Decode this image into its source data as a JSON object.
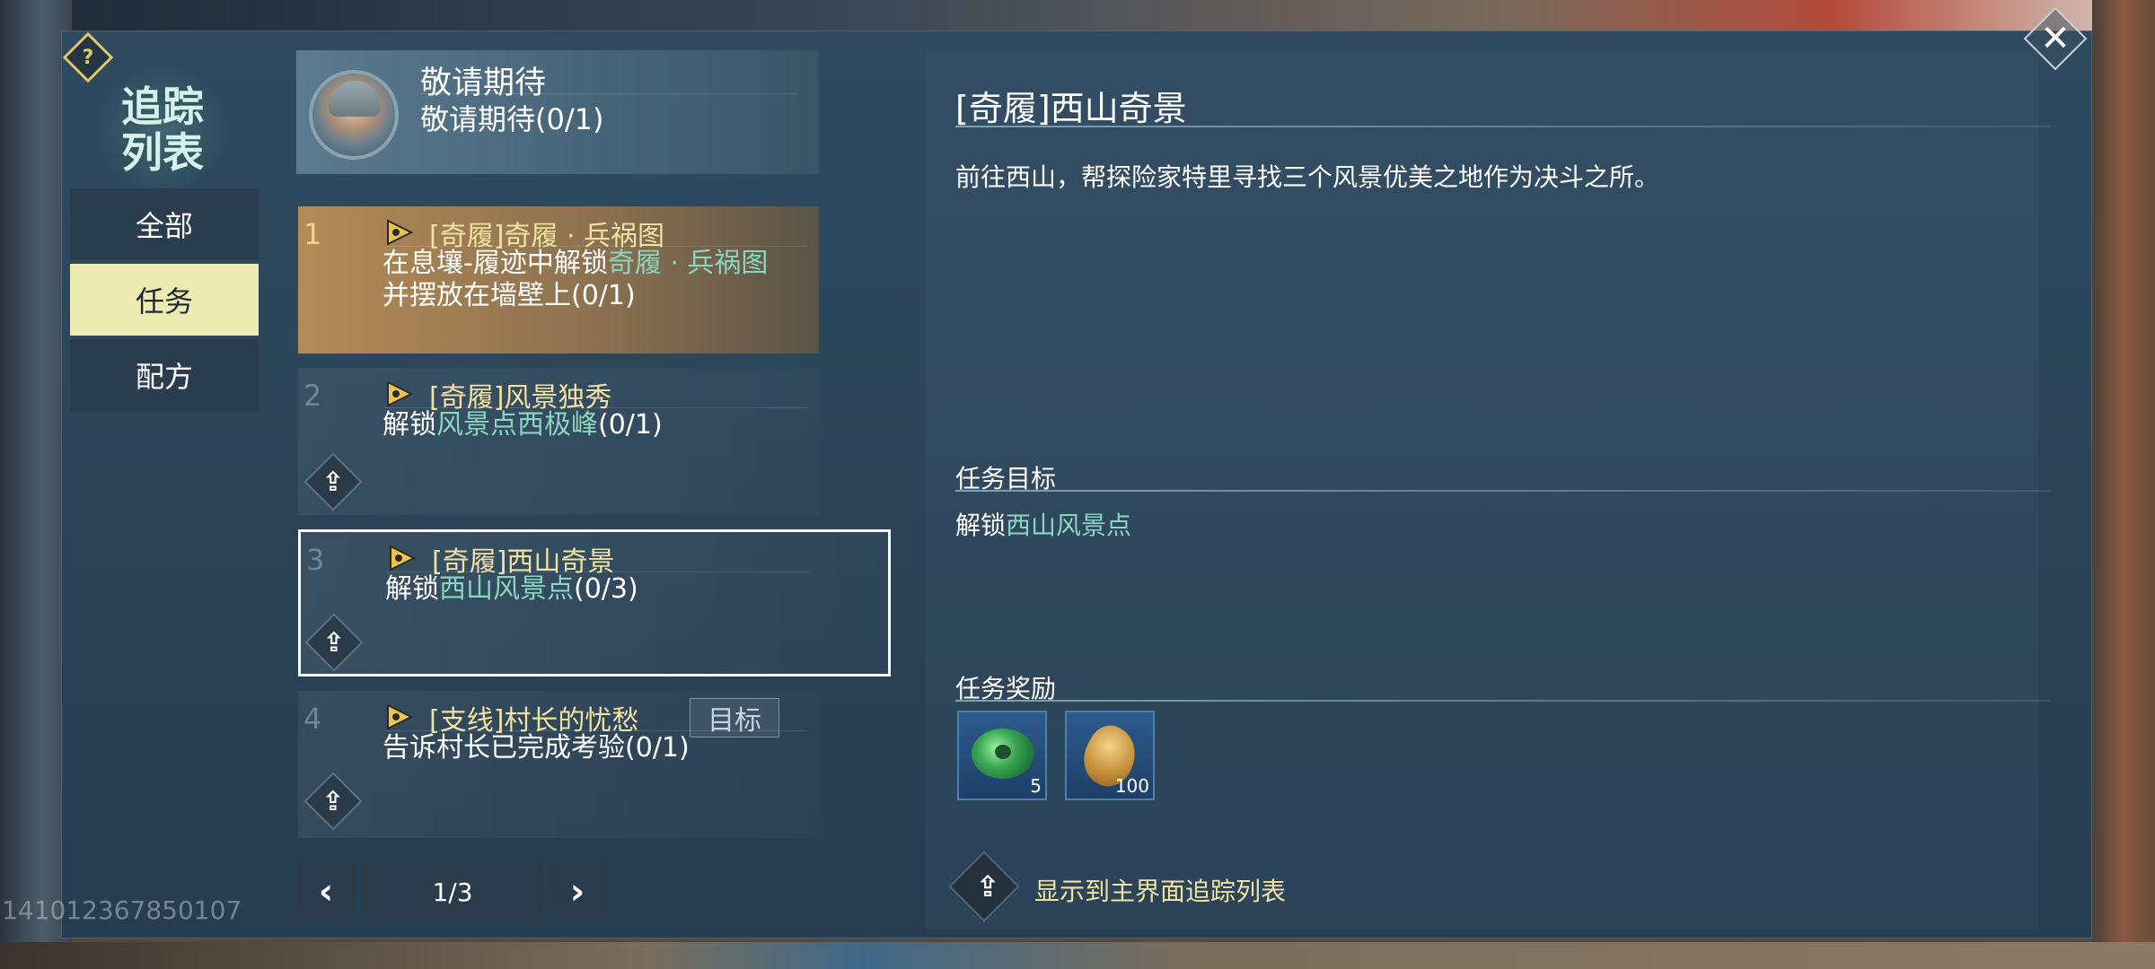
{
  "sidebar": {
    "title_line1": "追踪",
    "title_line2": "列表",
    "tabs": [
      {
        "label": "全部"
      },
      {
        "label": "任务"
      },
      {
        "label": "配方"
      }
    ]
  },
  "tracked": {
    "title": "敬请期待",
    "subtitle": "敬请期待(0/1)"
  },
  "quests": [
    {
      "num": "1",
      "title": "[奇履]奇履 · 兵祸图",
      "desc_pre": "在息壤-履迹中解锁",
      "desc_hl": "奇履 · 兵祸图",
      "desc_post": "并摆放在墙壁上(0/1)"
    },
    {
      "num": "2",
      "title": "[奇履]风景独秀",
      "desc_pre": "解锁",
      "desc_hl": "风景点西极峰",
      "desc_post": "(0/1)"
    },
    {
      "num": "3",
      "title": "[奇履]西山奇景",
      "desc_pre": "解锁",
      "desc_hl": "西山风景点",
      "desc_post": "(0/3)"
    },
    {
      "num": "4",
      "title": "[支线]村长的忧愁",
      "tag": "目标",
      "desc": "告诉村长已完成考验(0/1)"
    }
  ],
  "pager": {
    "prev": "‹",
    "next": "›",
    "page": "1/3"
  },
  "detail": {
    "title": "[奇履]西山奇景",
    "description": "前往西山，帮探险家特里寻找三个风景优美之地作为决斗之所。",
    "goal_label": "任务目标",
    "goal_pre": "解锁",
    "goal_hl": "西山风景点",
    "reward_label": "任务奖励",
    "rewards": [
      {
        "icon": "jade-icon",
        "count": "5"
      },
      {
        "icon": "shell-coin-icon",
        "count": "100"
      }
    ],
    "show_track_label": "显示到主界面追踪列表"
  },
  "uid": "141012367850107",
  "colors": {
    "highlight": "#8ad6c0",
    "title_gold": "#f1e2a2",
    "active_tab": "#ecebb2"
  }
}
